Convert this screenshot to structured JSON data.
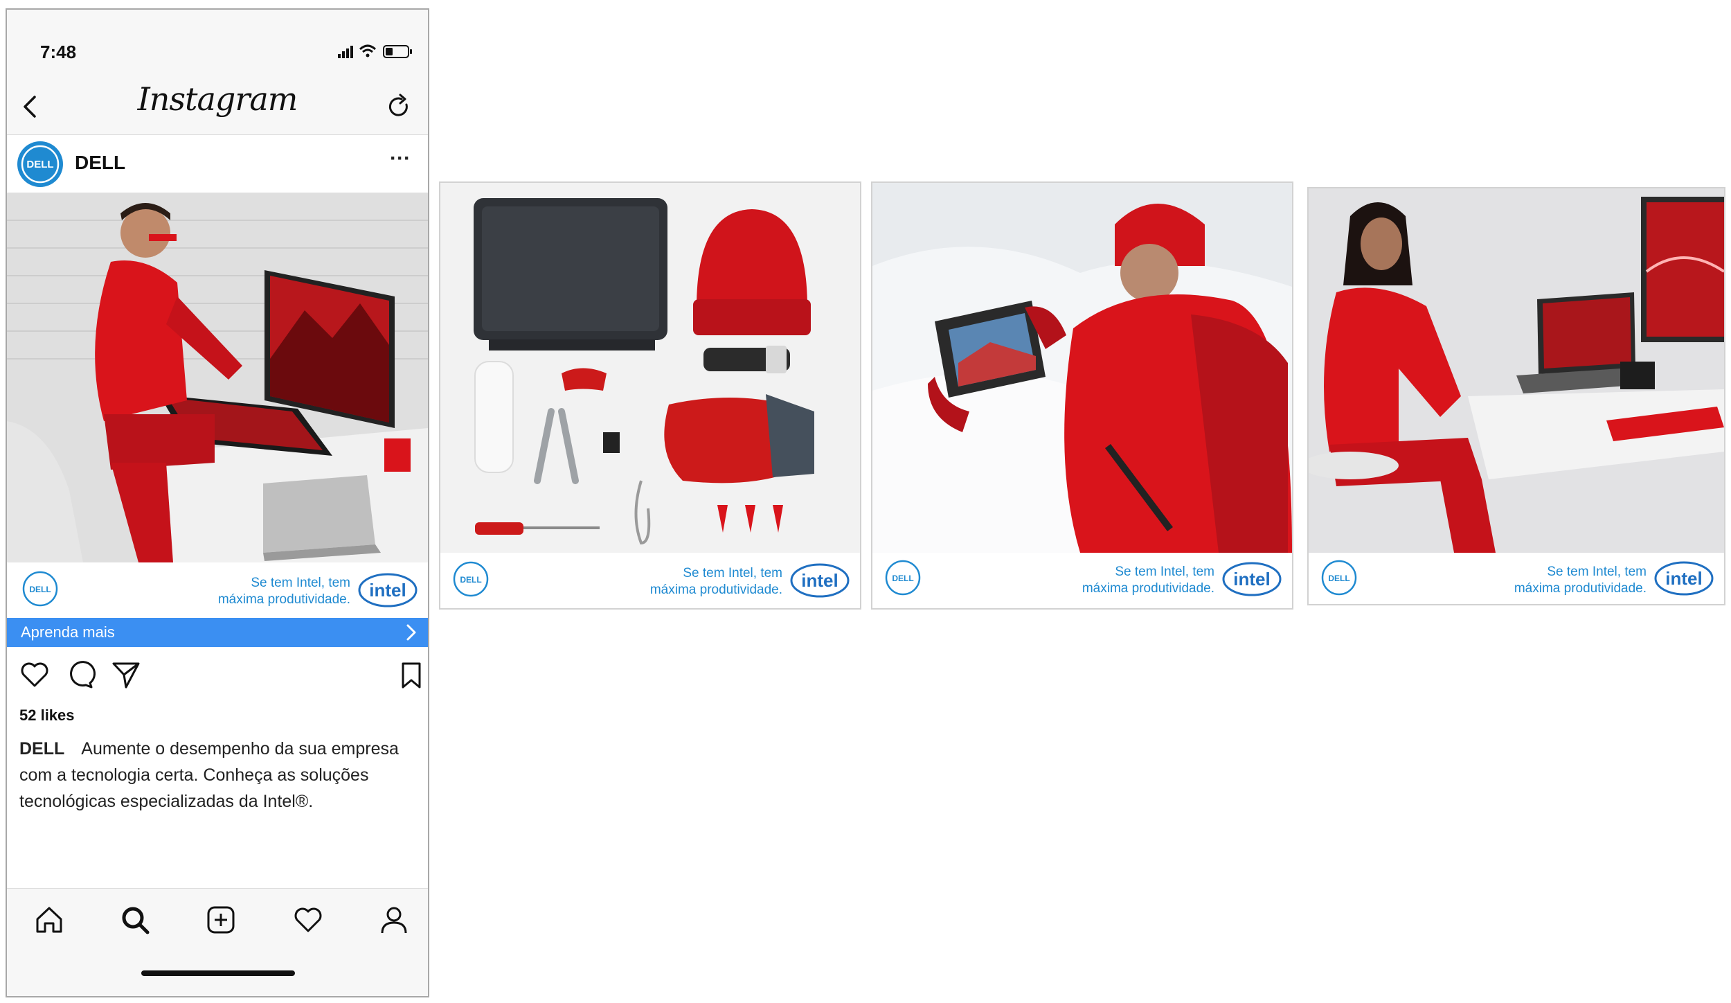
{
  "status_bar": {
    "time": "7:48"
  },
  "nav": {
    "title": "Instagram"
  },
  "post": {
    "username": "DELL",
    "more_label": "···",
    "ad": {
      "tagline_line1": "Se tem Intel, tem",
      "tagline_line2": "máxima produtividade."
    },
    "cta": {
      "label": "Aprenda mais"
    },
    "likes": "52 likes",
    "caption": {
      "user": "DELL",
      "text": "Aumente o desempenho da sua empresa com a tecnologia certa. Conheça as soluções tecnológicas especializadas da Intel®."
    }
  },
  "cards": [
    {
      "tagline_line1": "Se tem Intel, tem",
      "tagline_line2": "máxima produtividade."
    },
    {
      "tagline_line1": "Se tem Intel, tem",
      "tagline_line2": "máxima produtividade."
    },
    {
      "tagline_line1": "Se tem Intel, tem",
      "tagline_line2": "máxima produtividade."
    }
  ],
  "brand": {
    "dell_logo_text": "DELL",
    "intel_logo_text": "intel",
    "dell_blue": "#1f8ad1",
    "cta_blue": "#3b8ff2",
    "accent_red": "#d9141b"
  },
  "icons": {
    "nav": [
      "back-arrow-icon",
      "refresh-icon"
    ],
    "actions": [
      "heart-icon",
      "comment-icon",
      "share-icon",
      "bookmark-icon"
    ],
    "tabs": [
      "home-icon",
      "search-icon",
      "add-post-icon",
      "activity-heart-icon",
      "profile-icon"
    ]
  }
}
